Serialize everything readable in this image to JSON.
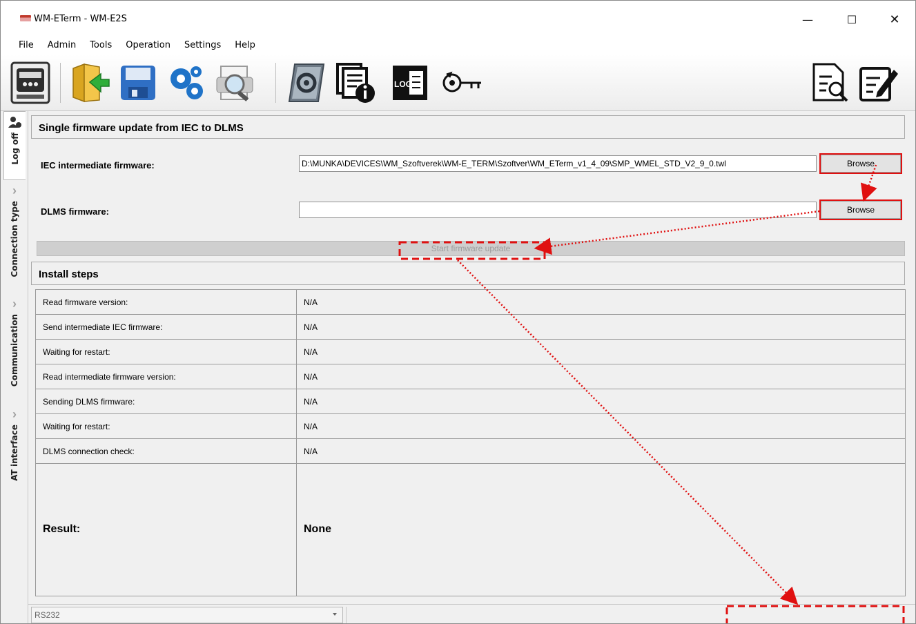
{
  "window": {
    "title": "WM-ETerm - WM-E2S",
    "minimize": "—",
    "maximize": "☐",
    "close": "✕"
  },
  "menu": {
    "items": [
      "File",
      "Admin",
      "Tools",
      "Operation",
      "Settings",
      "Help"
    ]
  },
  "toolbar": {
    "log_label": "LOG",
    "icons": [
      "meter-icon",
      "folder-import-icon",
      "save-icon",
      "gears-icon",
      "document-search-icon",
      "firmware-icon",
      "document-info-icon",
      "log-icon",
      "key-rotation-icon",
      "report-search-icon",
      "edit-document-icon"
    ]
  },
  "sidebar": {
    "tabs": [
      "Log off",
      "Connection type",
      "Communication",
      "AT interface"
    ]
  },
  "update": {
    "header": "Single firmware update from IEC to DLMS",
    "iec_label": "IEC intermediate firmware:",
    "iec_value": "D:\\MUNKA\\DEVICES\\WM_Szoftverek\\WM-E_TERM\\Szoftver\\WM_ETerm_v1_4_09\\SMP_WMEL_STD_V2_9_0.twl",
    "dlms_label": "DLMS firmware:",
    "dlms_value": "",
    "browse_label": "Browse",
    "start_label": "Start firmware update"
  },
  "install": {
    "header": "Install steps",
    "steps": [
      {
        "label": "Read firmware version:",
        "value": "N/A"
      },
      {
        "label": "Send intermediate IEC firmware:",
        "value": "N/A"
      },
      {
        "label": "Waiting for restart:",
        "value": "N/A"
      },
      {
        "label": "Read intermediate firmware version:",
        "value": "N/A"
      },
      {
        "label": "Sending DLMS firmware:",
        "value": "N/A"
      },
      {
        "label": "Waiting for restart:",
        "value": "N/A"
      },
      {
        "label": "DLMS connection check:",
        "value": "N/A"
      }
    ],
    "result_label": "Result:",
    "result_value": "None"
  },
  "statusbar": {
    "port": "RS232"
  },
  "colors": {
    "highlight": "#e01010",
    "window_bg": "#f0f0f0"
  }
}
